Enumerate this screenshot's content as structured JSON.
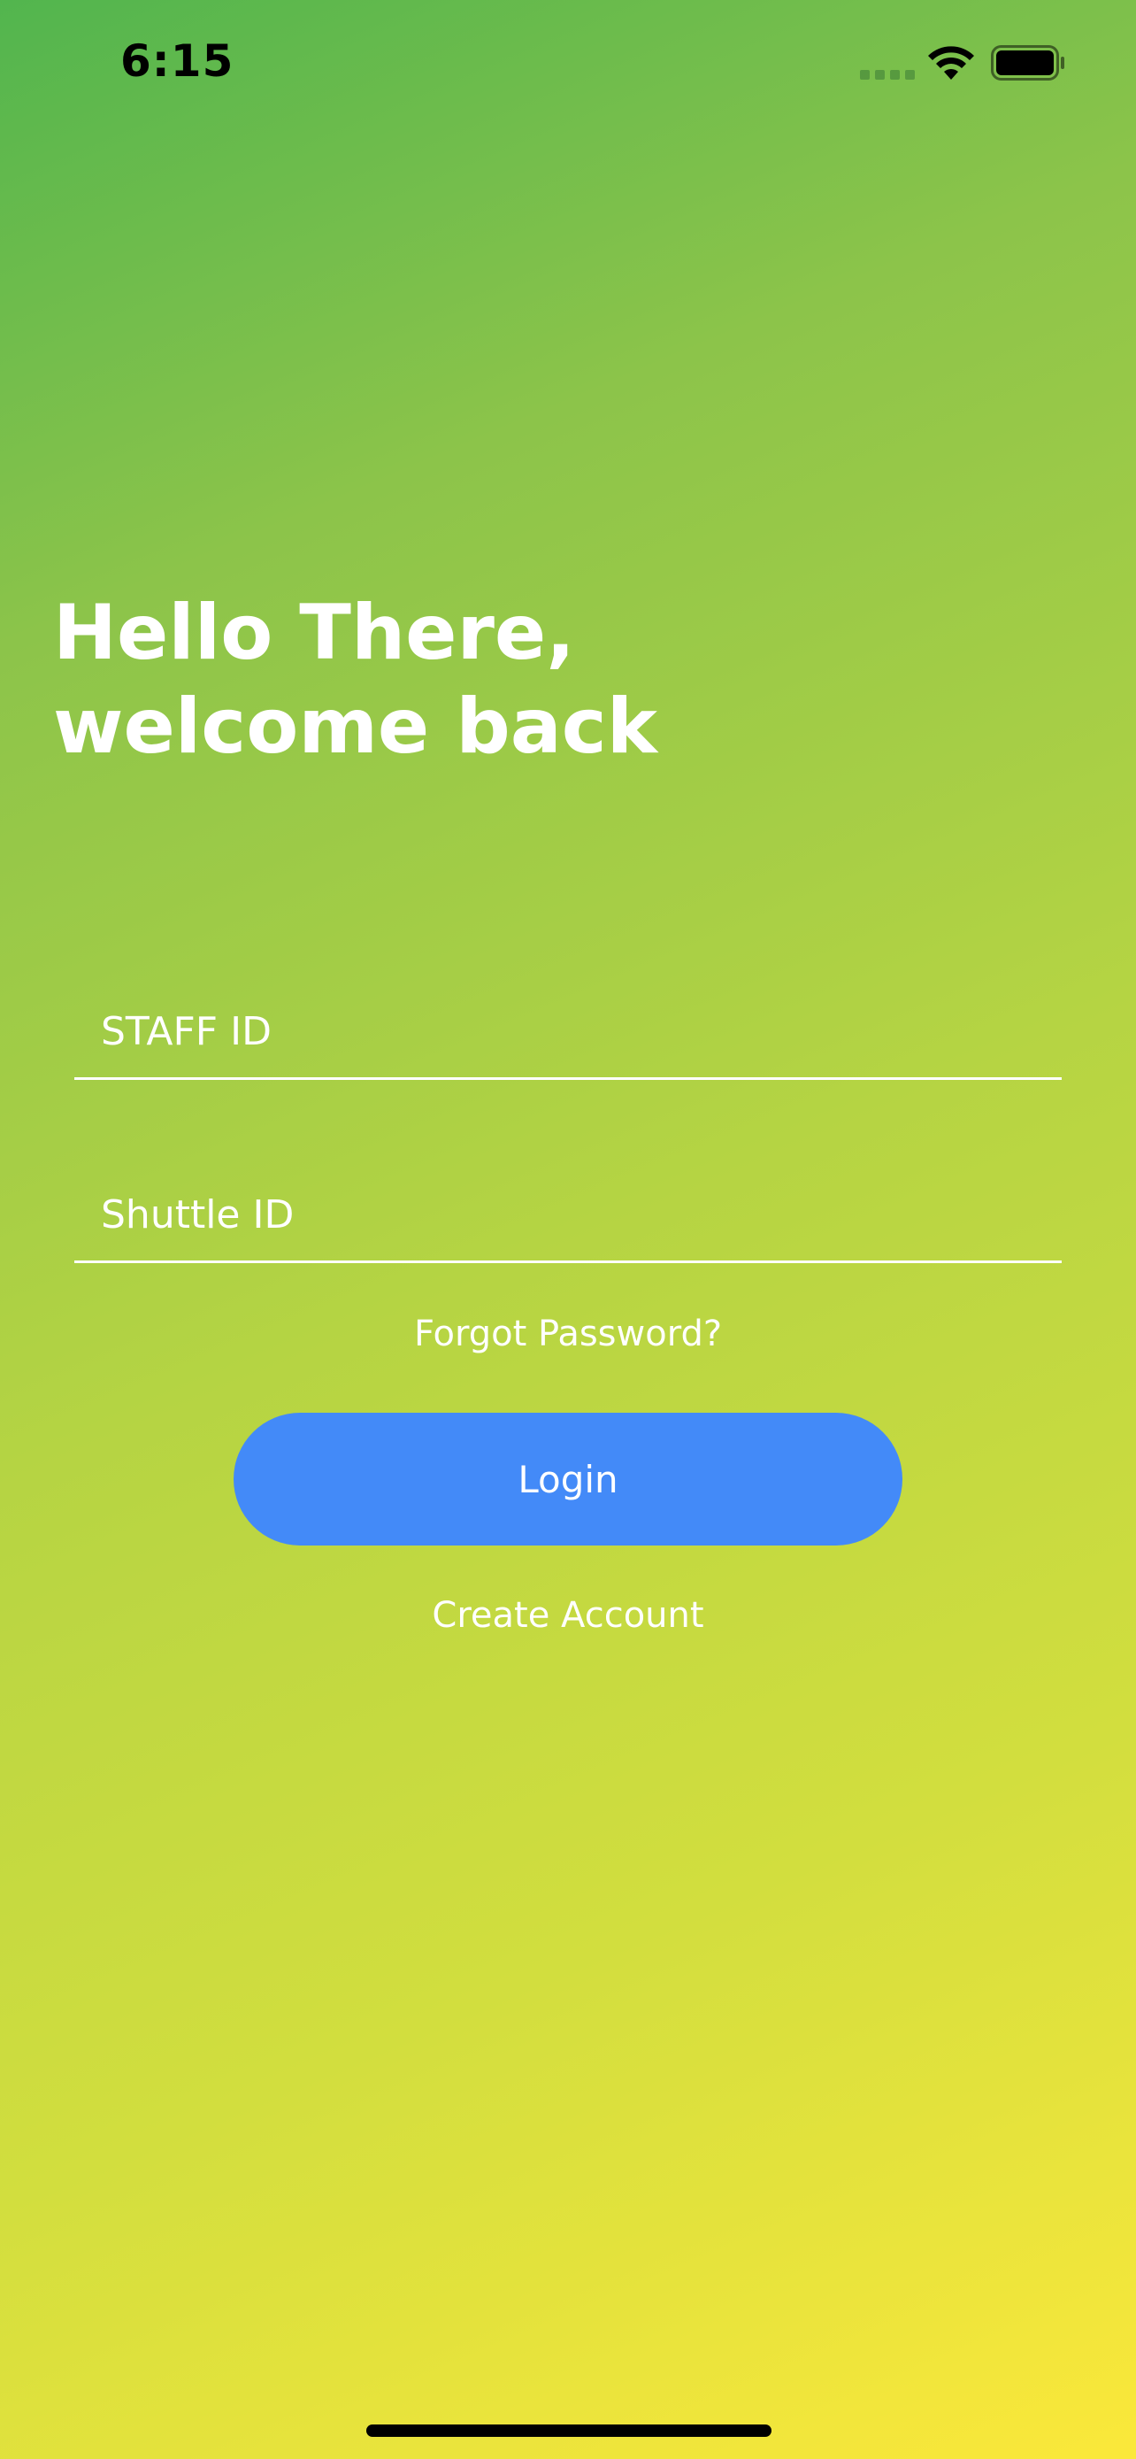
{
  "status_bar": {
    "time": "6:15",
    "icons": [
      "signal-dots-icon",
      "wifi-icon",
      "battery-icon"
    ]
  },
  "greeting": {
    "line1": "Hello There,",
    "line2": "welcome back"
  },
  "form": {
    "staff_id": {
      "placeholder": "STAFF ID",
      "value": ""
    },
    "shuttle_id": {
      "placeholder": "Shuttle ID",
      "value": ""
    }
  },
  "links": {
    "forgot_password": "Forgot Password?",
    "create_account": "Create Account"
  },
  "login_button": {
    "label": "Login"
  },
  "colors": {
    "gradient_top": "#52b54e",
    "gradient_bottom": "#fbe83a",
    "login_button": "#438af8",
    "text": "#ffffff"
  }
}
